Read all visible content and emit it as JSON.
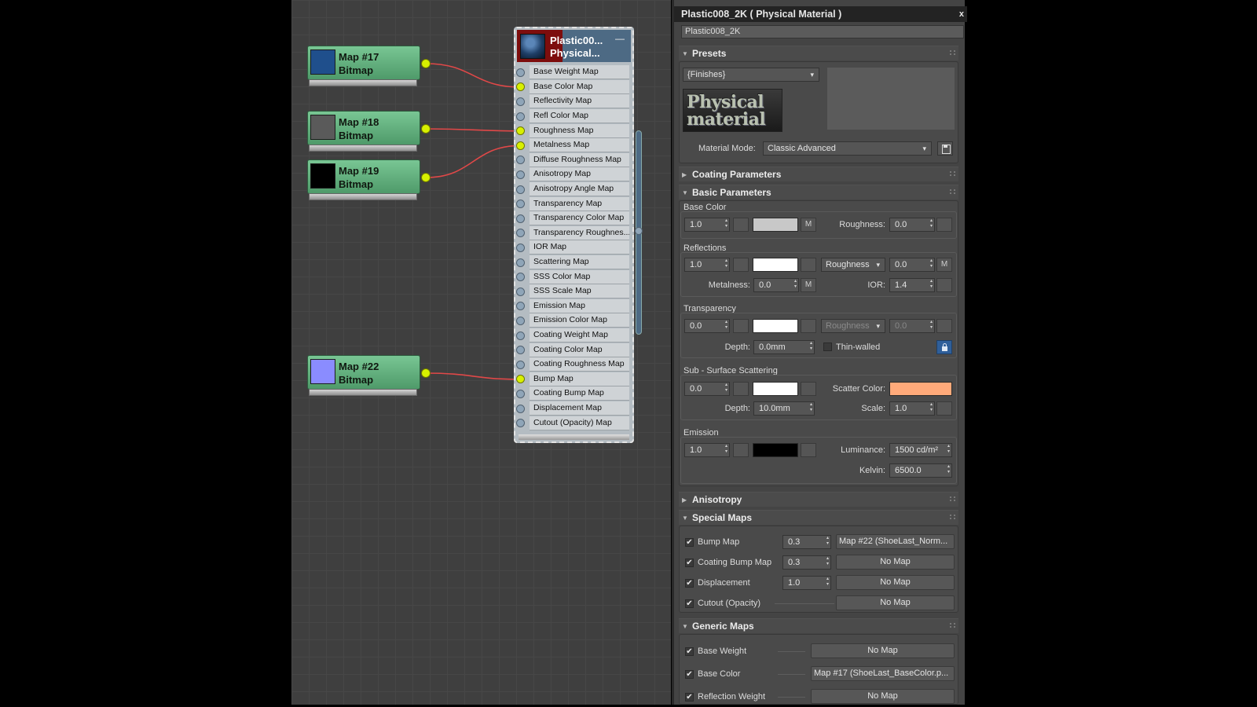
{
  "editor": {
    "map_nodes": [
      {
        "name": "Map #17",
        "type": "Bitmap",
        "swatch": "#1f4f8c"
      },
      {
        "name": "Map #18",
        "type": "Bitmap",
        "swatch": "#5a5a5a"
      },
      {
        "name": "Map #19",
        "type": "Bitmap",
        "swatch": "#000000"
      },
      {
        "name": "Map #22",
        "type": "Bitmap",
        "swatch": "#8a8cff"
      }
    ],
    "material_node": {
      "line1": "Plastic00...",
      "line2": "Physical...",
      "minimize": "—",
      "slots": [
        "Base Weight Map",
        "Base Color Map",
        "Reflectivity Map",
        "Refl Color Map",
        "Roughness Map",
        "Metalness Map",
        "Diffuse Roughness Map",
        "Anisotropy Map",
        "Anisotropy Angle Map",
        "Transparency Map",
        "Transparency Color Map",
        "Transparency Roughnes...",
        "IOR Map",
        "Scattering Map",
        "SSS Color Map",
        "SSS Scale Map",
        "Emission Map",
        "Emission Color Map",
        "Coating Weight Map",
        "Coating Color Map",
        "Coating Roughness Map",
        "Bump Map",
        "Coating Bump Map",
        "Displacement Map",
        "Cutout (Opacity) Map"
      ],
      "connected_slots": [
        1,
        4,
        5,
        21
      ]
    },
    "wire_color": "#e04848",
    "socket_color": "#d8f000"
  },
  "panel": {
    "title": "Plastic008_2K  ( Physical Material )",
    "close": "x",
    "material_name": "Plastic008_2K",
    "presets": {
      "header": "Presets",
      "preset_value": "{Finishes}",
      "logo_line1": "Physical",
      "logo_line2": "material",
      "material_mode_label": "Material Mode:",
      "material_mode_value": "Classic Advanced"
    },
    "coating": {
      "header": "Coating Parameters"
    },
    "basic": {
      "header": "Basic Parameters",
      "base_color": {
        "label": "Base Color",
        "weight": "1.0",
        "m": "M",
        "roughness_label": "Roughness:",
        "roughness": "0.0",
        "color": "#c8c8c8"
      },
      "reflections": {
        "label": "Reflections",
        "weight": "1.0",
        "mode": "Roughness",
        "roughness": "0.0",
        "m": "M",
        "metalness_label": "Metalness:",
        "metalness": "0.0",
        "m2": "M",
        "ior_label": "IOR:",
        "ior": "1.4",
        "color": "#ffffff"
      },
      "transparency": {
        "label": "Transparency",
        "weight": "0.0",
        "mode": "Roughness",
        "roughness": "0.0",
        "depth_label": "Depth:",
        "depth": "0.0mm",
        "thin_walled": "Thin-walled",
        "color": "#ffffff"
      },
      "sss": {
        "label": "Sub - Surface Scattering",
        "weight": "0.0",
        "scatter_color_label": "Scatter Color:",
        "depth_label": "Depth:",
        "depth": "10.0mm",
        "scale_label": "Scale:",
        "scale": "1.0",
        "color": "#ffffff",
        "scatter_color": "#ffaa7a"
      },
      "emission": {
        "label": "Emission",
        "weight": "1.0",
        "luminance_label": "Luminance:",
        "luminance": "1500 cd/m²",
        "kelvin_label": "Kelvin:",
        "kelvin": "6500.0",
        "color": "#000000"
      }
    },
    "anisotropy": {
      "header": "Anisotropy"
    },
    "special_maps": {
      "header": "Special Maps",
      "rows": [
        {
          "label": "Bump Map",
          "value": "0.3",
          "map": "Map #22 (ShoeLast_Norm..."
        },
        {
          "label": "Coating Bump Map",
          "value": "0.3",
          "map": "No Map"
        },
        {
          "label": "Displacement",
          "value": "1.0",
          "map": "No Map"
        },
        {
          "label": "Cutout (Opacity)",
          "value": "",
          "map": "No Map"
        }
      ]
    },
    "generic_maps": {
      "header": "Generic Maps",
      "rows": [
        {
          "label": "Base Weight",
          "map": "No Map"
        },
        {
          "label": "Base Color",
          "map": "Map #17 (ShoeLast_BaseColor.p..."
        },
        {
          "label": "Reflection Weight",
          "map": "No Map"
        }
      ]
    },
    "check": "✔",
    "expanded": "▼",
    "collapsed": "▶"
  }
}
